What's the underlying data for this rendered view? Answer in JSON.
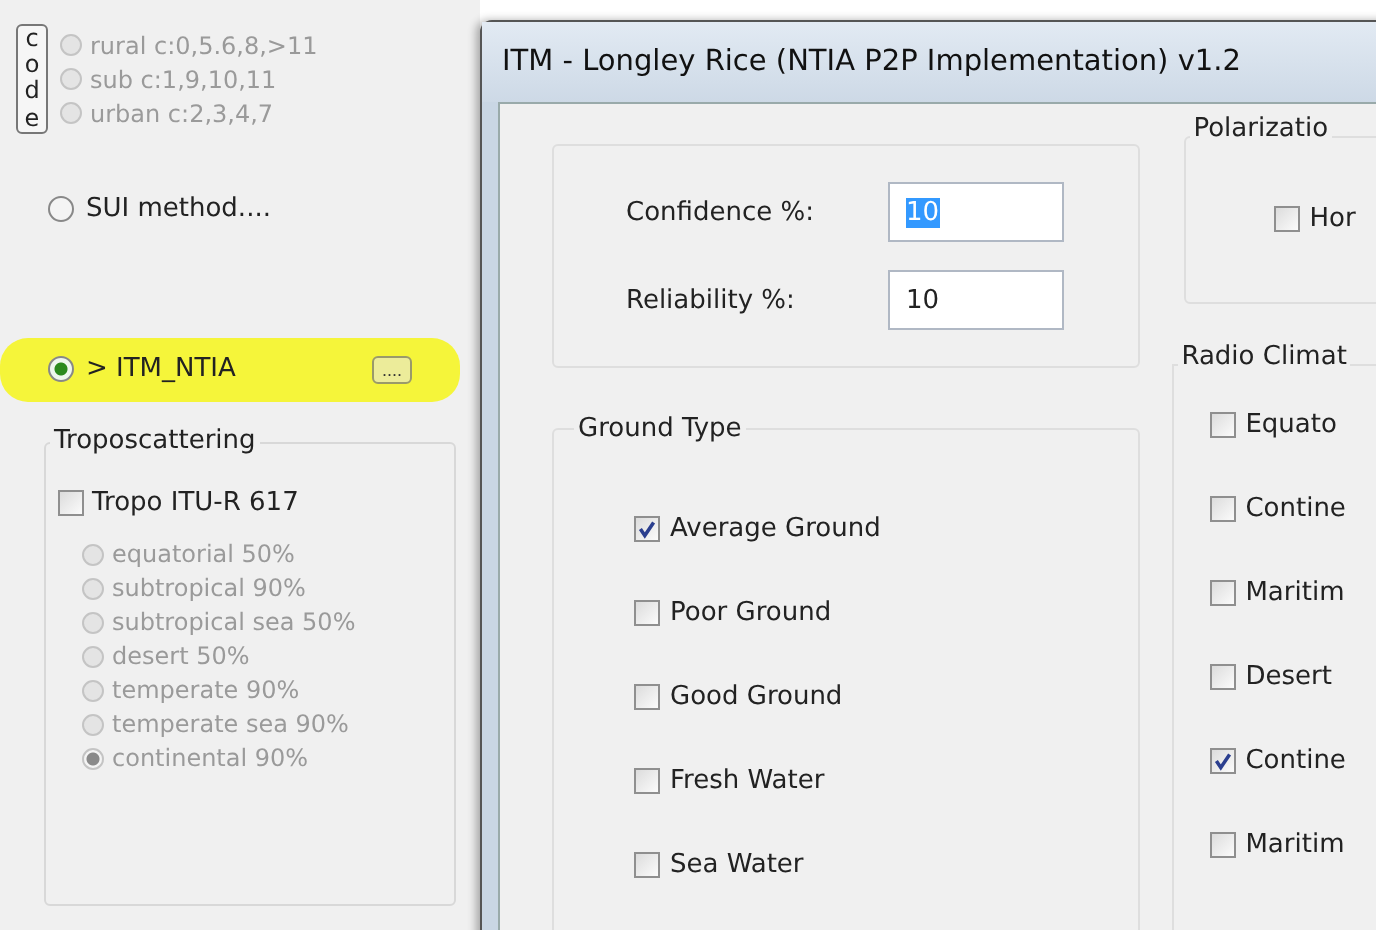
{
  "left_panel": {
    "code_label": "code",
    "code_options": [
      {
        "label": "rural c:0,5.6,8,>11",
        "selected": false,
        "disabled": true
      },
      {
        "label": "sub c:1,9,10,11",
        "selected": false,
        "disabled": true
      },
      {
        "label": "urban c:2,3,4,7",
        "selected": false,
        "disabled": true
      }
    ],
    "methods": [
      {
        "label": "SUI method....",
        "selected": false,
        "highlighted": false
      },
      {
        "label": "> ITM_NTIA",
        "selected": true,
        "highlighted": true,
        "button": "...."
      }
    ],
    "troposcattering": {
      "title": "Troposcattering",
      "checkbox": {
        "label": "Tropo ITU-R 617",
        "checked": false
      },
      "options": [
        {
          "label": "equatorial 50%",
          "selected": false,
          "disabled": true
        },
        {
          "label": "subtropical 90%",
          "selected": false,
          "disabled": true
        },
        {
          "label": "subtropical sea 50%",
          "selected": false,
          "disabled": true
        },
        {
          "label": "desert 50%",
          "selected": false,
          "disabled": true
        },
        {
          "label": "temperate 90%",
          "selected": false,
          "disabled": true
        },
        {
          "label": "temperate sea 90%",
          "selected": false,
          "disabled": true
        },
        {
          "label": "continental 90%",
          "selected": true,
          "disabled": true
        }
      ]
    }
  },
  "dialog": {
    "title": "ITM - Longley Rice (NTIA P2P Implementation) v1.2",
    "fields": [
      {
        "label": "Confidence %:",
        "value": "10",
        "text_selected": true
      },
      {
        "label": "Reliability %:",
        "value": "10",
        "text_selected": false
      }
    ],
    "ground_type": {
      "title": "Ground Type",
      "items": [
        {
          "label": "Average Ground",
          "checked": true
        },
        {
          "label": "Poor Ground",
          "checked": false
        },
        {
          "label": "Good Ground",
          "checked": false
        },
        {
          "label": "Fresh Water",
          "checked": false
        },
        {
          "label": "Sea Water",
          "checked": false
        }
      ]
    },
    "polarization": {
      "title": "Polarizatio",
      "items": [
        {
          "label": "Hor",
          "checked": false
        }
      ]
    },
    "radio_climate": {
      "title": "Radio Climat",
      "items": [
        {
          "label": "Equato",
          "checked": false
        },
        {
          "label": "Contine",
          "checked": false
        },
        {
          "label": "Maritim",
          "checked": false
        },
        {
          "label": "Desert",
          "checked": false
        },
        {
          "label": "Contine",
          "checked": true
        },
        {
          "label": "Maritim",
          "checked": false
        }
      ]
    }
  }
}
